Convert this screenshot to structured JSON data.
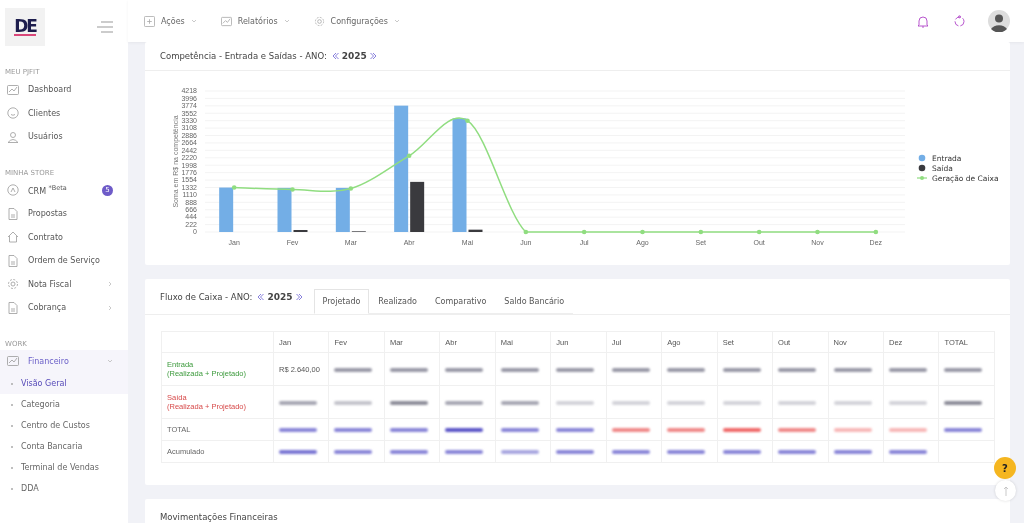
{
  "sidebar": {
    "logo": "DE",
    "sections": [
      {
        "title": "MEU PJFIT",
        "items": [
          {
            "label": "Dashboard",
            "selected": false
          },
          {
            "label": "Clientes",
            "selected": false
          },
          {
            "label": "Usuários",
            "selected": false
          }
        ]
      },
      {
        "title": "MINHA STORE",
        "items": [
          {
            "label": "CRM $^{*Beta}$",
            "badge": "5",
            "selected": false
          },
          {
            "label": "Propostas",
            "selected": false
          },
          {
            "label": "Contrato",
            "selected": false
          },
          {
            "label": "Ordem de Serviço",
            "selected": false
          },
          {
            "label": "Nota Fiscal",
            "submenu": true,
            "selected": false
          },
          {
            "label": "Cobrança",
            "submenu": true,
            "selected": false
          }
        ]
      },
      {
        "title": "WORK",
        "items": [
          {
            "label": "Financeiro",
            "submenu": true,
            "expanded": true,
            "selected": true,
            "children": [
              {
                "label": "Visão Geral",
                "selected": true
              },
              {
                "label": "Categoria",
                "selected": false
              },
              {
                "label": "Centro de Custos",
                "selected": false
              },
              {
                "label": "Conta Bancaria",
                "selected": false
              },
              {
                "label": "Terminal de Vendas",
                "selected": false
              },
              {
                "label": "DDA",
                "selected": false
              }
            ]
          }
        ]
      }
    ]
  },
  "topbar": {
    "menus": [
      {
        "label": "Ações"
      },
      {
        "label": "Relatórios"
      },
      {
        "label": "Configurações"
      }
    ]
  },
  "competencia": {
    "title": "Competência - Entrada e Saídas - ANO:",
    "year": "2025",
    "chart_data": {
      "type": "bar",
      "ylabel": "Soma em R$ na competência",
      "categories": [
        "Jan",
        "Fev",
        "Mar",
        "Abr",
        "Mai",
        "Jun",
        "Jul",
        "Ago",
        "Set",
        "Out",
        "Nov",
        "Dez"
      ],
      "series": [
        {
          "name": "Entrada",
          "color": "#73aee6",
          "values": [
            1330,
            1320,
            1320,
            3780,
            3400,
            0,
            0,
            0,
            0,
            0,
            0,
            0
          ]
        },
        {
          "name": "Saída",
          "color": "#3a3a3e",
          "values": [
            0,
            60,
            20,
            1500,
            70,
            0,
            0,
            0,
            0,
            0,
            0,
            0
          ]
        },
        {
          "name": "Geração de Caixa",
          "color": "#90dd80",
          "type": "line",
          "values": [
            1330,
            1270,
            1300,
            2280,
            3330,
            0,
            0,
            0,
            0,
            0,
            0,
            0
          ]
        }
      ],
      "ylim": [
        0,
        4218
      ],
      "grid": true,
      "legend": true,
      "stacked": false,
      "yticks": [
        0,
        222,
        444,
        666,
        888,
        1110,
        1332,
        1554,
        1776,
        1998,
        2220,
        2442,
        2664,
        2886,
        3108,
        3330,
        3552,
        3774,
        3996,
        4218
      ]
    }
  },
  "fluxo": {
    "title": "Fluxo de Caixa - ANO:",
    "year": "2025",
    "tabs": [
      {
        "label": "Projetado",
        "selected": true
      },
      {
        "label": "Realizado",
        "selected": false
      },
      {
        "label": "Comparativo",
        "selected": false
      },
      {
        "label": "Saldo Bancário",
        "selected": false
      }
    ],
    "columns": [
      "Jan",
      "Fev",
      "Mar",
      "Abr",
      "Mai",
      "Jun",
      "Jul",
      "Ago",
      "Set",
      "Out",
      "Nov",
      "Dez",
      "TOTAL"
    ],
    "rows": [
      {
        "label": "Entrada",
        "sublabel": "(Realizada + Projetado)",
        "kind": "entrada",
        "cells": [
          {
            "text": "R$ 2.640,00"
          },
          {
            "kind": "blurred",
            "color": "#9a9aa8"
          },
          {
            "kind": "blurred",
            "color": "#9a9aa8"
          },
          {
            "kind": "blurred",
            "color": "#9a9aa8"
          },
          {
            "kind": "blurred",
            "color": "#9a9aa8"
          },
          {
            "kind": "blurred",
            "color": "#9a9aa8"
          },
          {
            "kind": "blurred",
            "color": "#9a9aa8"
          },
          {
            "kind": "blurred",
            "color": "#9a9aa8"
          },
          {
            "kind": "blurred",
            "color": "#9a9aa8"
          },
          {
            "kind": "blurred",
            "color": "#9a9aa8"
          },
          {
            "kind": "blurred",
            "color": "#9a9aa8"
          },
          {
            "kind": "blurred",
            "color": "#9a9aa8"
          },
          {
            "kind": "blurred",
            "color": "#9a9aa8"
          }
        ]
      },
      {
        "label": "Saída",
        "sublabel": "(Realizada + Projetado)",
        "kind": "saida",
        "cells": [
          {
            "kind": "blurred",
            "color": "#a8a8b4"
          },
          {
            "kind": "blurred",
            "color": "#c4c4cc"
          },
          {
            "kind": "blurred",
            "color": "#8e8e9a"
          },
          {
            "kind": "blurred",
            "color": "#a8a8b4"
          },
          {
            "kind": "blurred",
            "color": "#a8a8b4"
          },
          {
            "kind": "blurred",
            "color": "#d4d4da"
          },
          {
            "kind": "blurred",
            "color": "#d4d4da"
          },
          {
            "kind": "blurred",
            "color": "#d4d4da"
          },
          {
            "kind": "blurred",
            "color": "#d4d4da"
          },
          {
            "kind": "blurred",
            "color": "#d4d4da"
          },
          {
            "kind": "blurred",
            "color": "#d4d4da"
          },
          {
            "kind": "blurred",
            "color": "#d4d4da"
          },
          {
            "kind": "blurred",
            "color": "#8e8e9a"
          }
        ]
      },
      {
        "label": "TOTAL",
        "kind": "plain",
        "cells": [
          {
            "kind": "blurred",
            "color": "#8a86d8"
          },
          {
            "kind": "blurred",
            "color": "#8a86d8"
          },
          {
            "kind": "blurred",
            "color": "#8a86d8"
          },
          {
            "kind": "blurred",
            "color": "#5c56c8"
          },
          {
            "kind": "blurred",
            "color": "#8a86d8"
          },
          {
            "kind": "blurred",
            "color": "#8a86d8"
          },
          {
            "kind": "blurred",
            "color": "#f08a8a"
          },
          {
            "kind": "blurred",
            "color": "#f08a8a"
          },
          {
            "kind": "blurred",
            "color": "#f06a6a"
          },
          {
            "kind": "blurred",
            "color": "#f08a8a"
          },
          {
            "kind": "blurred",
            "color": "#f8b8b8"
          },
          {
            "kind": "blurred",
            "color": "#f8b8b8"
          },
          {
            "kind": "blurred",
            "color": "#8a86d8"
          }
        ]
      },
      {
        "label": "Acumulado",
        "kind": "plain",
        "cells": [
          {
            "kind": "blurred",
            "color": "#7a76d4"
          },
          {
            "kind": "blurred",
            "color": "#8a86d8"
          },
          {
            "kind": "blurred",
            "color": "#8a86d8"
          },
          {
            "kind": "blurred",
            "color": "#8a86d8"
          },
          {
            "kind": "blurred",
            "color": "#a8a6e0"
          },
          {
            "kind": "blurred",
            "color": "#8a86d8"
          },
          {
            "kind": "blurred",
            "color": "#8a86d8"
          },
          {
            "kind": "blurred",
            "color": "#8a86d8"
          },
          {
            "kind": "blurred",
            "color": "#8a86d8"
          },
          {
            "kind": "blurred",
            "color": "#8a86d8"
          },
          {
            "kind": "blurred",
            "color": "#8a86d8"
          },
          {
            "kind": "blurred",
            "color": "#8a86d8"
          }
        ]
      }
    ]
  },
  "movimentacoes": {
    "title": "Movimentações Financeiras"
  },
  "help_button": "?"
}
